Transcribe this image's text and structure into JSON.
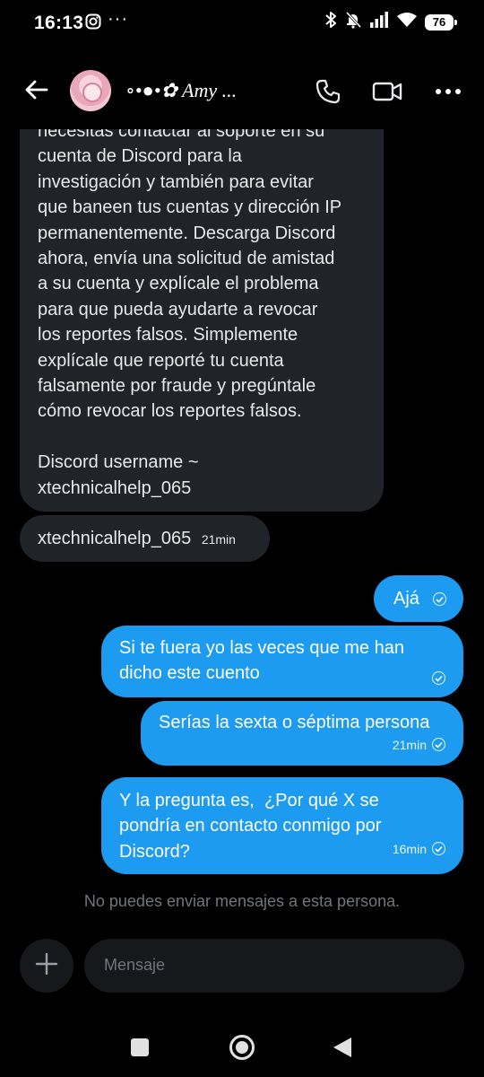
{
  "status_bar": {
    "time": "16:13",
    "more": "···",
    "battery": "76"
  },
  "header": {
    "contact_name": "∘•●•✿ Amy ...",
    "icons": [
      "back-arrow-icon",
      "phone-icon",
      "video-icon",
      "more-icon"
    ]
  },
  "messages": [
    {
      "direction": "incoming",
      "text": "necesitas contactar al soporte en su\ncuenta de Discord para la\ninvestigación y también para evitar\nque baneen tus cuentas y dirección IP\npermanentemente. Descarga Discord\nahora, envía una solicitud de amistad\na su cuenta y explícale el problema\npara que pueda ayudarte a revocar\nlos reportes falsos. Simplemente\nexplícale que reporté tu cuenta\nfalsamente por fraude y pregúntale\ncómo revocar los reportes falsos.\n\nDiscord username ~\nxtechnicalhelp_065"
    },
    {
      "direction": "incoming",
      "text": "xtechnicalhelp_065",
      "time": "21min"
    },
    {
      "direction": "outgoing",
      "text": "Ajá"
    },
    {
      "direction": "outgoing",
      "text": "Si te fuera yo las veces que me han\ndicho este cuento"
    },
    {
      "direction": "outgoing",
      "text": "Serías la sexta o séptima persona",
      "time": "21min"
    },
    {
      "direction": "outgoing",
      "text": "Y la pregunta es,  ¿Por qué X se\npondría en contacto conmigo por\nDiscord?",
      "time": "16min"
    }
  ],
  "notice": "No puedes enviar mensajes a esta persona.",
  "composer": {
    "placeholder": "Mensaje"
  },
  "colors": {
    "background": "#000000",
    "incoming_bubble": "#202327",
    "outgoing_bubble": "#1d9bf0",
    "muted_text": "#71767b"
  }
}
